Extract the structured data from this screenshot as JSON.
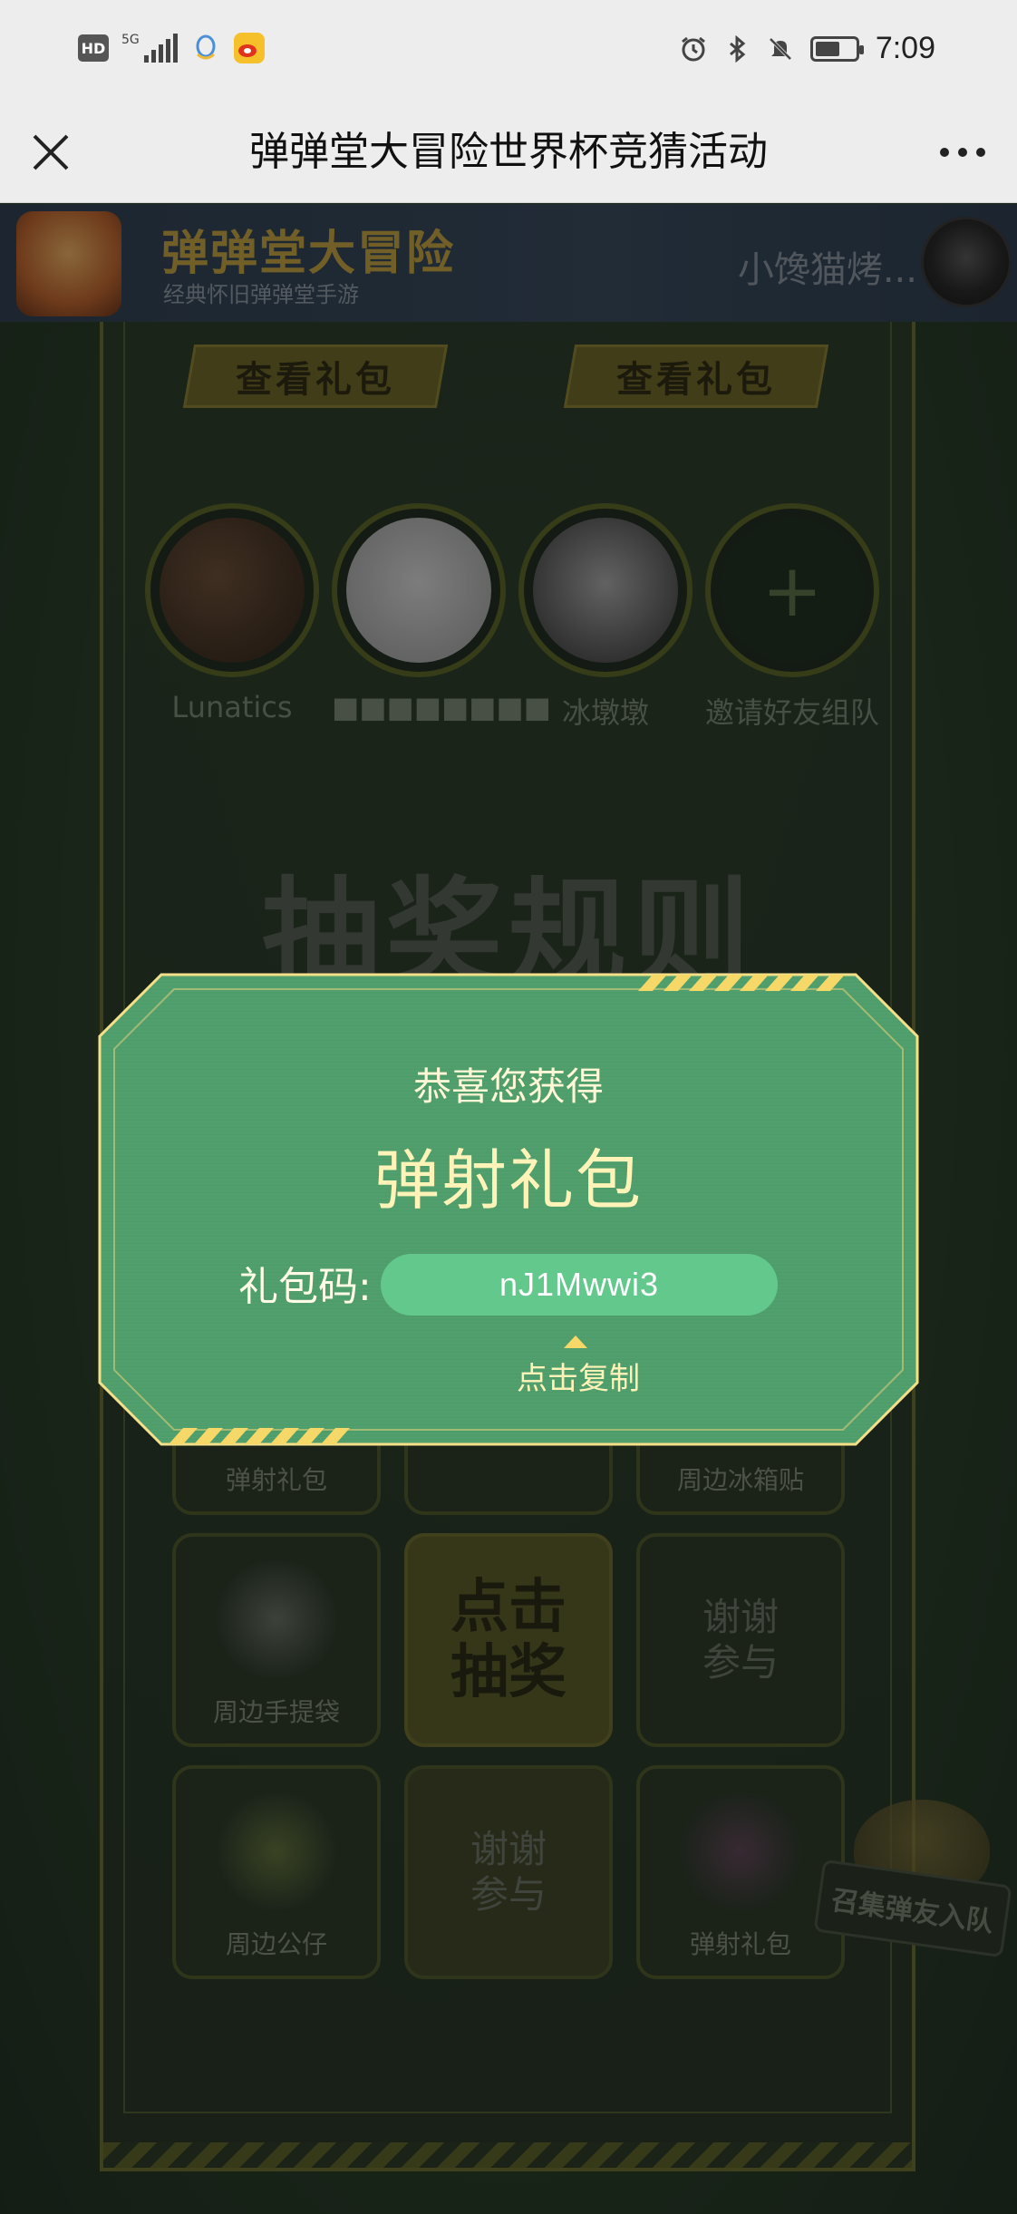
{
  "status_bar": {
    "hd": "HD",
    "network": "5G",
    "time": "7:09",
    "icons": [
      "hd-icon",
      "signal-icon",
      "qq-icon",
      "weibo-icon",
      "alarm-icon",
      "bluetooth-icon",
      "mute-icon",
      "battery-icon"
    ]
  },
  "title_bar": {
    "title": "弹弹堂大冒险世界杯竞猜活动",
    "close_icon": "close-icon",
    "more_icon": "more-icon"
  },
  "game_header": {
    "name": "弹弹堂大冒险",
    "subtitle": "经典怀旧弹弹堂手游",
    "user_name": "小馋猫烤..."
  },
  "gift_buttons": [
    "查看礼包",
    "查看礼包"
  ],
  "team": [
    {
      "name": "Lunatics"
    },
    {
      "name": "■■■■■■■■"
    },
    {
      "name": "冰墩墩"
    },
    {
      "name": "邀请好友组队",
      "icon": "plus-icon"
    }
  ],
  "rules_title": "抽奖规则",
  "prize_grid": [
    {
      "label": "弹射礼包"
    },
    {
      "label": ""
    },
    {
      "label": "周边冰箱贴"
    },
    {
      "label": "周边手提袋"
    },
    {
      "label": "点击\n抽奖",
      "type": "draw"
    },
    {
      "label": "谢谢\n参与",
      "type": "thanks"
    },
    {
      "label": "周边公仔"
    },
    {
      "label": "谢谢\n参与",
      "type": "thanks"
    },
    {
      "label": "弹射礼包"
    }
  ],
  "recruit_label": "召集弹友入队",
  "modal": {
    "title": "恭喜您获得",
    "prize": "弹射礼包",
    "code_label": "礼包码:",
    "code": "nJ1Mwwi3",
    "copy_label": "点击复制",
    "colors": {
      "panel": "#4a9e6a",
      "border": "#f5e08a",
      "code_bg": "#63c88b"
    }
  }
}
